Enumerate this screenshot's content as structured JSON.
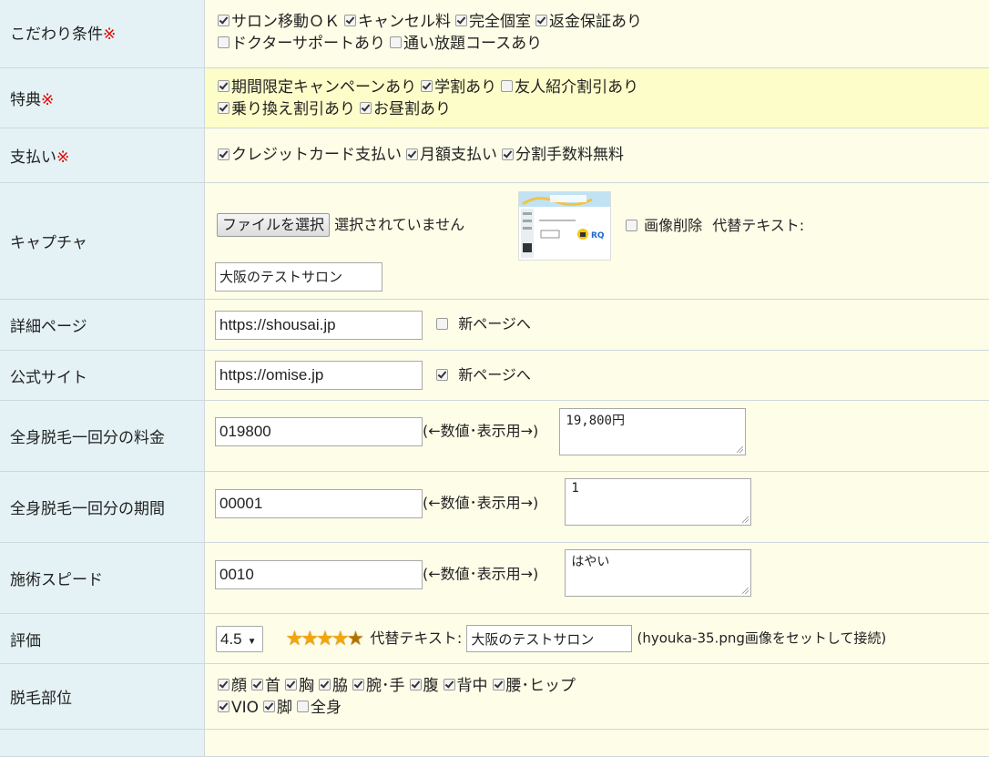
{
  "rows": {
    "kodawari": {
      "label": "こだわり条件",
      "req": "※",
      "options": [
        {
          "label": "サロン移動ＯＫ",
          "checked": true
        },
        {
          "label": "キャンセル料",
          "checked": true
        },
        {
          "label": "完全個室",
          "checked": true
        },
        {
          "label": "返金保証あり",
          "checked": true
        },
        {
          "label": "ドクターサポートあり",
          "checked": false
        },
        {
          "label": "通い放題コースあり",
          "checked": false
        }
      ]
    },
    "tokuten": {
      "label": "特典",
      "req": "※",
      "options": [
        {
          "label": "期間限定キャンペーンあり",
          "checked": true
        },
        {
          "label": "学割あり",
          "checked": true
        },
        {
          "label": "友人紹介割引あり",
          "checked": false
        },
        {
          "label": "乗り換え割引あり",
          "checked": true
        },
        {
          "label": "お昼割あり",
          "checked": true
        }
      ]
    },
    "shiharai": {
      "label": "支払い",
      "req": "※",
      "options": [
        {
          "label": "クレジットカード支払い",
          "checked": true
        },
        {
          "label": "月額支払い",
          "checked": true
        },
        {
          "label": "分割手数料無料",
          "checked": true
        }
      ]
    },
    "capture": {
      "label": "キャプチャ",
      "file_button": "ファイルを選択",
      "file_status": "選択されていません",
      "delete_label": "画像削除",
      "delete_checked": false,
      "alt_label": "代替テキスト:",
      "alt_value": "大阪のテストサロン"
    },
    "detail": {
      "label": "詳細ページ",
      "url": "https://shousai.jp",
      "newpage_label": "新ページへ",
      "newpage_checked": false
    },
    "official": {
      "label": "公式サイト",
      "url": "https://omise.jp",
      "newpage_label": "新ページへ",
      "newpage_checked": true
    },
    "price": {
      "label": "全身脱毛一回分の料金",
      "value": "019800",
      "hint": "(←数値･表示用→)",
      "display": "19,800円"
    },
    "period": {
      "label": "全身脱毛一回分の期間",
      "value": "00001",
      "hint": "(←数値･表示用→)",
      "display": "1"
    },
    "speed": {
      "label": "施術スピード",
      "value": "0010",
      "hint": "(←数値･表示用→)",
      "display": "はやい"
    },
    "rating": {
      "label": "評価",
      "select_value": "4.5",
      "stars": 4.5,
      "alt_label": "代替テキスト:",
      "alt_value": "大阪のテストサロン",
      "note": "(hyouka-35.png画像をセットして接続)"
    },
    "parts": {
      "label": "脱毛部位",
      "options": [
        {
          "label": "顔",
          "checked": true
        },
        {
          "label": "首",
          "checked": true
        },
        {
          "label": "胸",
          "checked": true
        },
        {
          "label": "脇",
          "checked": true
        },
        {
          "label": "腕･手",
          "checked": true
        },
        {
          "label": "腹",
          "checked": true
        },
        {
          "label": "背中",
          "checked": true
        },
        {
          "label": "腰･ヒップ",
          "checked": true
        },
        {
          "label": "VIO",
          "checked": true
        },
        {
          "label": "脚",
          "checked": true
        },
        {
          "label": "全身",
          "checked": false
        }
      ]
    }
  },
  "colors": {
    "required": "#e00000",
    "label_bg": "#e4f2f5",
    "value_bg": "#fdfde8",
    "highlight_bg": "#fdfdc9"
  }
}
